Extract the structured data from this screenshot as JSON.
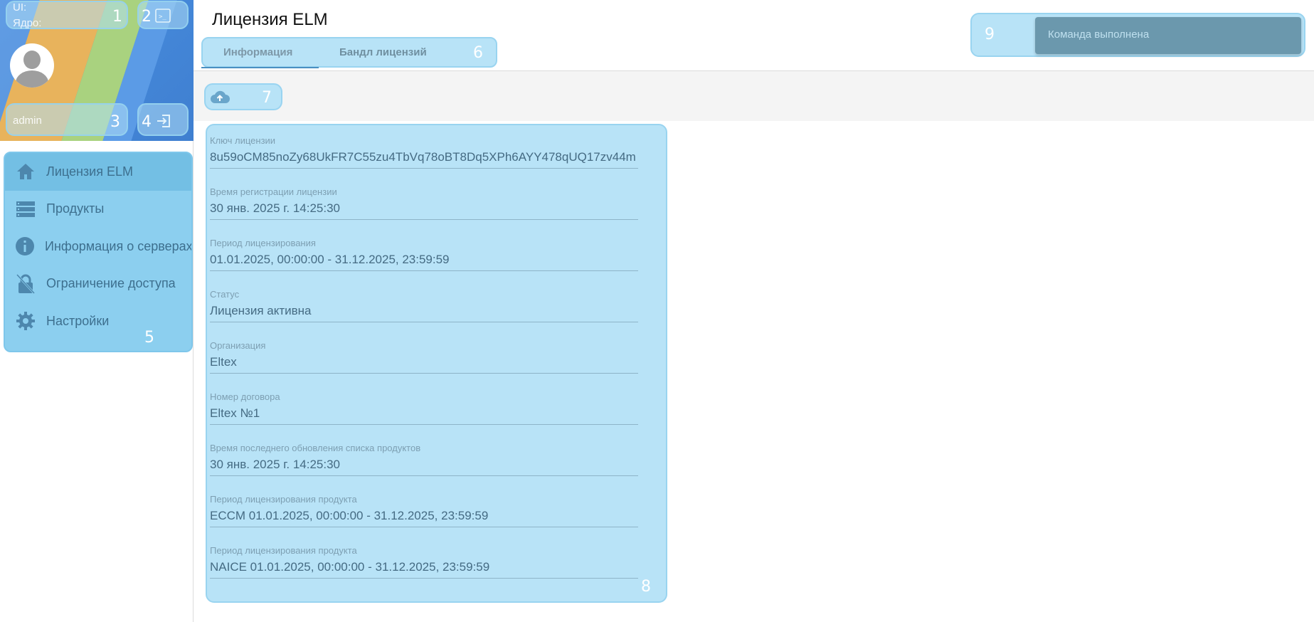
{
  "sidebar": {
    "versions": {
      "ui_label": "UI:",
      "core_label": "Ядро:"
    },
    "username": "admin",
    "menu": [
      {
        "label": "Лицензия ELM",
        "icon": "home-icon",
        "active": true
      },
      {
        "label": "Продукты",
        "icon": "list-icon",
        "active": false
      },
      {
        "label": "Информация о серверах",
        "icon": "info-icon",
        "active": false
      },
      {
        "label": "Ограничение доступа",
        "icon": "lock-off-icon",
        "active": false
      },
      {
        "label": "Настройки",
        "icon": "gear-icon",
        "active": false
      }
    ]
  },
  "header": {
    "title": "Лицензия ELM",
    "tabs": [
      {
        "label": "Информация",
        "active": true
      },
      {
        "label": "Бандл лицензий",
        "active": false
      }
    ]
  },
  "toolbar": {
    "upload_icon": "cloud-upload-icon"
  },
  "license_info": {
    "fields": [
      {
        "label": "Ключ лицензии",
        "value": "8u59oCM85noZy68UkFR7C55zu4TbVq78oBT8Dq5XPh6AYY478qUQ17zv44m"
      },
      {
        "label": "Время регистрации лицензии",
        "value": "30 янв. 2025 г. 14:25:30"
      },
      {
        "label": "Период лицензирования",
        "value": "01.01.2025, 00:00:00 - 31.12.2025, 23:59:59"
      },
      {
        "label": "Статус",
        "value": "Лицензия активна"
      },
      {
        "label": "Организация",
        "value": "Eltex"
      },
      {
        "label": "Номер договора",
        "value": "Eltex №1"
      },
      {
        "label": "Время последнего обновления списка продуктов",
        "value": "30 янв. 2025 г. 14:25:30"
      },
      {
        "label": "Период лицензирования продукта",
        "value": "ECCM 01.01.2025, 00:00:00 - 31.12.2025, 23:59:59"
      },
      {
        "label": "Период лицензирования продукта",
        "value": "NAICE 01.01.2025, 00:00:00 - 31.12.2025, 23:59:59"
      }
    ]
  },
  "notification": {
    "text": "Команда выполнена"
  },
  "overlay_labels": [
    "1",
    "2",
    "3",
    "4",
    "5",
    "6",
    "7",
    "8",
    "9"
  ],
  "colors": {
    "overlay_fill": "#b8e3f7",
    "overlay_border": "#99d4f0",
    "menu_text": "#3d6f8e",
    "field_value": "#456b83",
    "notification_bg": "#6b98ad"
  }
}
